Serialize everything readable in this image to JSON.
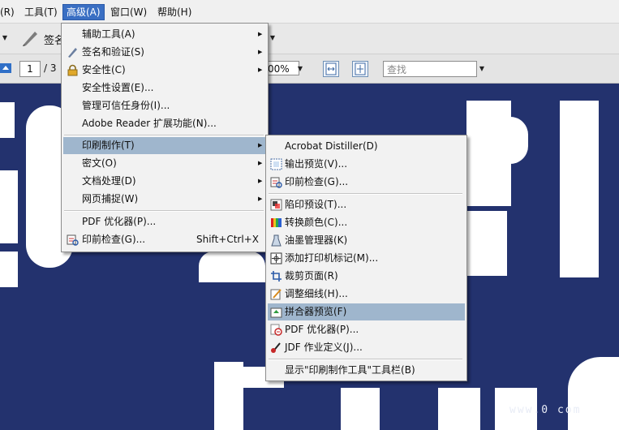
{
  "menubar": {
    "items": [
      {
        "label": "(R)"
      },
      {
        "label": "工具(T)"
      },
      {
        "label": "高级(A)"
      },
      {
        "label": "窗口(W)"
      },
      {
        "label": "帮助(H)"
      }
    ]
  },
  "toolbar": {
    "row1_partial_label": "签名",
    "page_number": "1",
    "page_total": "/ 3",
    "zoom": "00%",
    "search_placeholder": "查找"
  },
  "advanced_menu": {
    "items": [
      {
        "label": "辅助工具(A)",
        "submenu": true
      },
      {
        "label": "签名和验证(S)",
        "submenu": true,
        "icon": "pen-icon"
      },
      {
        "label": "安全性(C)",
        "submenu": true,
        "icon": "lock-icon"
      },
      {
        "label": "安全性设置(E)..."
      },
      {
        "label": "管理可信任身份(I)..."
      },
      {
        "label": "Adobe Reader 扩展功能(N)..."
      },
      {
        "label": "印刷制作(T)",
        "submenu": true,
        "highlighted": true
      },
      {
        "label": "密文(O)",
        "submenu": true
      },
      {
        "label": "文档处理(D)",
        "submenu": true
      },
      {
        "label": "网页捕捉(W)",
        "submenu": true
      },
      {
        "label": "PDF 优化器(P)..."
      },
      {
        "label": "印前检查(G)...",
        "shortcut": "Shift+Ctrl+X",
        "icon": "preflight-icon"
      }
    ]
  },
  "print_production_menu": {
    "items": [
      {
        "label": "Acrobat Distiller(D)"
      },
      {
        "label": "输出预览(V)...",
        "icon": "output-preview-icon"
      },
      {
        "label": "印前检查(G)...",
        "icon": "preflight-icon"
      },
      {
        "label": "陷印预设(T)...",
        "icon": "trap-presets-icon"
      },
      {
        "label": "转换颜色(C)...",
        "icon": "convert-colors-icon"
      },
      {
        "label": "油墨管理器(K)",
        "icon": "ink-manager-icon"
      },
      {
        "label": "添加打印机标记(M)...",
        "icon": "printer-marks-icon"
      },
      {
        "label": "裁剪页面(R)",
        "icon": "crop-pages-icon"
      },
      {
        "label": "调整细线(H)...",
        "icon": "fix-hairlines-icon"
      },
      {
        "label": "拼合器预览(F)",
        "icon": "flattener-preview-icon",
        "highlighted": true
      },
      {
        "label": "PDF 优化器(P)...",
        "icon": "pdf-optimizer-icon"
      },
      {
        "label": "JDF 作业定义(J)...",
        "icon": "jdf-icon"
      },
      {
        "label": "显示\"印刷制作工具\"工具栏(B)"
      }
    ]
  },
  "watermark": "www.0 com",
  "colors": {
    "document_background": "#23326e",
    "menu_highlight": "#9fb6cd",
    "menubar_active": "#3a6fc3"
  }
}
